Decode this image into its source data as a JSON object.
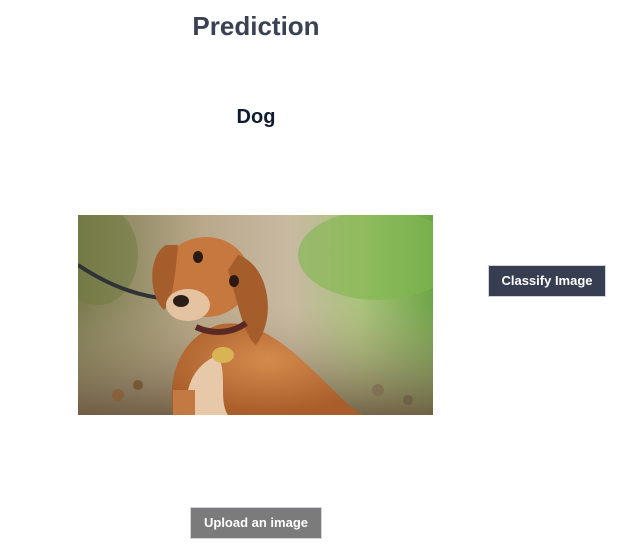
{
  "header": {
    "title": "Prediction"
  },
  "prediction": {
    "label": "Dog"
  },
  "image": {
    "alt": "dog-photo"
  },
  "buttons": {
    "classify_label": "Classify Image",
    "upload_label": "Upload an image"
  },
  "colors": {
    "title": "#3a4152",
    "result": "#0f1a33",
    "classify_bg": "#373e52",
    "upload_bg": "#7b7b7b"
  }
}
